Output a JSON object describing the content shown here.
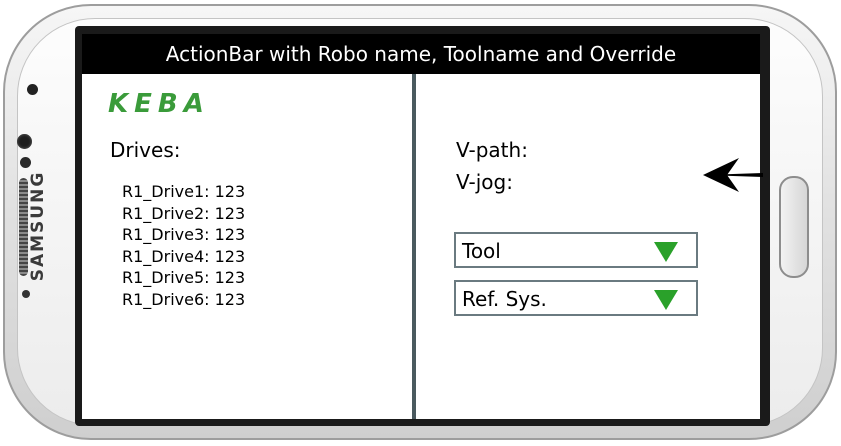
{
  "device": {
    "brand": "SAMSUNG"
  },
  "actionbar": {
    "title": "ActionBar with Robo name, Toolname and Override"
  },
  "logo": {
    "text": "KEBA"
  },
  "drives": {
    "title": "Drives:",
    "items": [
      {
        "label": "R1_Drive1: 123"
      },
      {
        "label": "R1_Drive2: 123"
      },
      {
        "label": "R1_Drive3: 123"
      },
      {
        "label": "R1_Drive4: 123"
      },
      {
        "label": "R1_Drive5: 123"
      },
      {
        "label": "R1_Drive6: 123"
      }
    ]
  },
  "speeds": {
    "vpath_label": "V-path:",
    "vjog_label": "V-jog:"
  },
  "dropdowns": {
    "tool": {
      "label": "Tool"
    },
    "ref_sys": {
      "label": "Ref. Sys."
    }
  },
  "colors": {
    "logo_green": "#3a9b3a",
    "dropdown_arrow": "#2aa12a",
    "divider": "#4a5a5f"
  },
  "icons": {
    "pointer": "arrow-left-icon",
    "dropdown": "triangle-down-icon"
  }
}
